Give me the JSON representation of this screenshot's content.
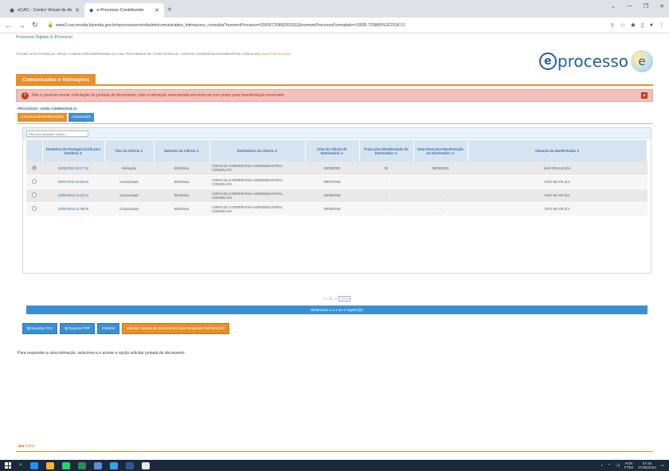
{
  "browser": {
    "tabs": [
      {
        "label": "eCAC - Centro Virtual de Atendi"
      },
      {
        "label": "e-Processo Contribuinte"
      }
    ],
    "url": "www3.cav.receita.fazenda.gov.br/eprocessocontribuinte/comunicados_intimacoes_consultar?numeroProcesso=10935720860201811&numeroProcessoFormatado=10935.720860%2F2018-11"
  },
  "bookmarks": {
    "item": "Processos Digitais (e-Processo)"
  },
  "header": {
    "titular": "TITULAR: 02.017.972/0001-53 - RESULT CONSULTORIA EMPRESARIAL E E LTDA. PROCURADOR DE: 76.093.731/0001-90 - COPACOL COOPERATIVA AGROINDUSTRIAL CONSOLATA |",
    "alterar": "Alterar Perfil de Acesso",
    "module_tab": "Comunicados e Intimações",
    "logo_e": "e",
    "logo_text": "processo",
    "logo_mark": "e"
  },
  "alert": {
    "message": "Não é possível enviar solicitação de juntada de documento, pois a intimação selecionada encontra-se com prazo para manifestação encerrado."
  },
  "processo": "PROCESSO: 10935.720860/2018-11",
  "subtabs": [
    "Comunicados/Intimações",
    "Arquivados"
  ],
  "filter": {
    "placeholder": "Filtro por qualquer campo..."
  },
  "table": {
    "headers": [
      "Data/Hora da Postagem (Link para Detalhar) ⇕",
      "Tipo da Ciência ⇕",
      "Natureza da Ciência ⇕",
      "Destinatário da Ciência ⇕",
      "Data da Ciência do Destinatário ⇕",
      "Prazo para Manifestação do Destinatário ⇕",
      "Data Final para Manifestação do Destinatário ⇕",
      "Situação da Manifestação ⇕"
    ],
    "rows": [
      {
        "posted": "05/05/2022 08:27:18",
        "tipo": "Intimação",
        "natureza": "Eletrônica",
        "destinatario": "COPACOL-COOPERATIVA AGROINDUSTRIAL CONSOLATA",
        "data_ciencia": "05/05/2022",
        "prazo": "30",
        "data_final": "06/06/2022",
        "situacao": "NÃO REALIZADA"
      },
      {
        "posted": "09/07/2018 10:56:53",
        "tipo": "Comunicado",
        "natureza": "Eletrônica",
        "destinatario": "COPACOL-COOPERATIVA AGROINDUSTRIAL CONSOLATA",
        "data_ciencia": "09/07/2018",
        "prazo": "-",
        "data_final": "-",
        "situacao": "NÃO SE APLICA"
      },
      {
        "posted": "18/06/2018 11:04:14",
        "tipo": "Comunicado",
        "natureza": "Eletrônica",
        "destinatario": "COPACOL-COOPERATIVA AGROINDUSTRIAL CONSOLATA",
        "data_ciencia": "19/06/2018",
        "prazo": "-",
        "data_final": "-",
        "situacao": "NÃO SE APLICA"
      },
      {
        "posted": "30/05/2018 11:46:59",
        "tipo": "Comunicado",
        "natureza": "Eletrônica",
        "destinatario": "COPACOL-COOPERATIVA AGROINDUSTRIAL CONSOLATA",
        "data_ciencia": "30/05/2018",
        "prazo": "-",
        "data_final": "-",
        "situacao": "NÃO SE APLICA"
      }
    ],
    "selected_row": 0
  },
  "pager": {
    "first": "«",
    "prev": "‹",
    "page": "1",
    "next": "›",
    "last": "»",
    "per_page": "10 ▾"
  },
  "showing": "Mostrando 1 a 4 de 4 registro(s)",
  "actions": {
    "export_csv": "Exportar CSV",
    "export_pdf": "Exportar PDF",
    "print": "Imprimir",
    "solicitar": "Solicitar Juntada de Documentos para Responder INTIMAÇÃO"
  },
  "help_text": "Para responder a uma intimação, selecione-a e acione a opção solicitar juntada de documento.",
  "voltar": "◀◀ Voltar",
  "tray": {
    "lang1": "POR",
    "lang2": "PTB2",
    "time": "07:48",
    "date": "07/06/2022"
  },
  "colors": {
    "accent_orange": "#e98f2a",
    "accent_blue": "#3b8fd4",
    "alert_bg": "#f5c0b8"
  }
}
